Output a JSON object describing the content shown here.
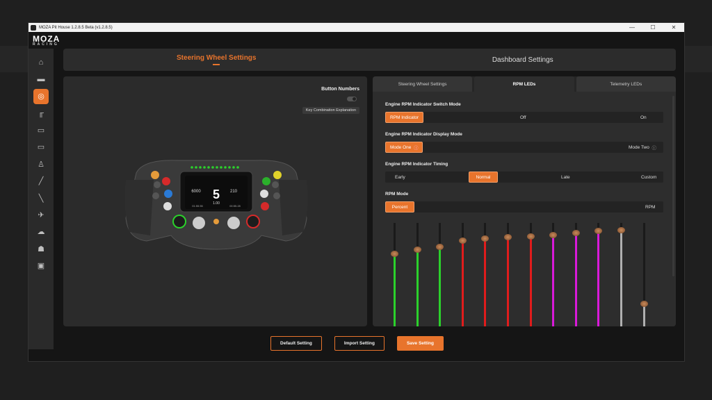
{
  "window": {
    "title": "MOZA Pit House 1.2.8.5 Beta (v1.2.8.5)"
  },
  "logo": {
    "main": "MOZA",
    "sub": "RACING"
  },
  "sidebar": {
    "items": [
      {
        "icon": "home-icon",
        "glyph": "⌂"
      },
      {
        "icon": "wheelbase-icon",
        "glyph": "▬"
      },
      {
        "icon": "steering-wheel-icon",
        "glyph": "◎",
        "active": true
      },
      {
        "icon": "pedals-icon",
        "glyph": "╓"
      },
      {
        "icon": "dashboard-icon",
        "glyph": "▭"
      },
      {
        "icon": "display-icon",
        "glyph": "▭"
      },
      {
        "icon": "shifter-icon",
        "glyph": "♙"
      },
      {
        "icon": "handbrake-icon",
        "glyph": "╱"
      },
      {
        "icon": "sequential-icon",
        "glyph": "╲"
      },
      {
        "icon": "flight-icon",
        "glyph": "✈"
      },
      {
        "icon": "cloud-icon",
        "glyph": "☁"
      },
      {
        "icon": "user-icon",
        "glyph": "☗"
      },
      {
        "icon": "chat-icon",
        "glyph": "▣"
      }
    ]
  },
  "top_tabs": [
    {
      "label": "Steering Wheel Settings",
      "active": true
    },
    {
      "label": "Dashboard Settings",
      "active": false
    }
  ],
  "wheel_panel": {
    "button_numbers_label": "Button Numbers",
    "button_numbers_on": false,
    "key_combo_label": "Key Combination Explanation",
    "display": {
      "speed": "6000",
      "gear": "5",
      "value2": "210",
      "value3": "1.00",
      "time1": "01:55.55",
      "time2": "00:55.28"
    }
  },
  "sub_tabs": [
    {
      "label": "Steering Wheel Settings",
      "active": false
    },
    {
      "label": "RPM LEDs",
      "active": true
    },
    {
      "label": "Telemetry LEDs",
      "active": false
    }
  ],
  "rpm": {
    "switch_mode": {
      "label": "Engine RPM Indicator Switch Mode",
      "options": [
        "RPM Indicator",
        "Off",
        "On"
      ],
      "selected": "RPM Indicator"
    },
    "display_mode": {
      "label": "Engine RPM Indicator Display Mode",
      "options": [
        "Mode One",
        "Mode Two"
      ],
      "selected": "Mode One",
      "info_icon": "info-icon"
    },
    "timing": {
      "label": "Engine RPM Indicator Timing",
      "options": [
        "Early",
        "Normal",
        "Late",
        "Custom"
      ],
      "selected": "Normal"
    },
    "rpm_mode": {
      "label": "RPM Mode",
      "options": [
        "Percent",
        "RPM"
      ],
      "selected": "Percent"
    },
    "leds": [
      {
        "color": "#2bd12b",
        "level": 0.7
      },
      {
        "color": "#2bd12b",
        "level": 0.74
      },
      {
        "color": "#2bd12b",
        "level": 0.77
      },
      {
        "color": "#e01c1c",
        "level": 0.83
      },
      {
        "color": "#e01c1c",
        "level": 0.85
      },
      {
        "color": "#e01c1c",
        "level": 0.86
      },
      {
        "color": "#e01c1c",
        "level": 0.87
      },
      {
        "color": "#d91ad9",
        "level": 0.88
      },
      {
        "color": "#d91ad9",
        "level": 0.9
      },
      {
        "color": "#d91ad9",
        "level": 0.92
      },
      {
        "color": "#b0b0b0",
        "level": 0.93
      },
      {
        "color": "#b0b0b0",
        "level": 0.22
      }
    ]
  },
  "bottom_buttons": {
    "default": "Default Setting",
    "import": "Import Setting",
    "save": "Save Setting"
  },
  "colors": {
    "accent": "#e8742c"
  }
}
